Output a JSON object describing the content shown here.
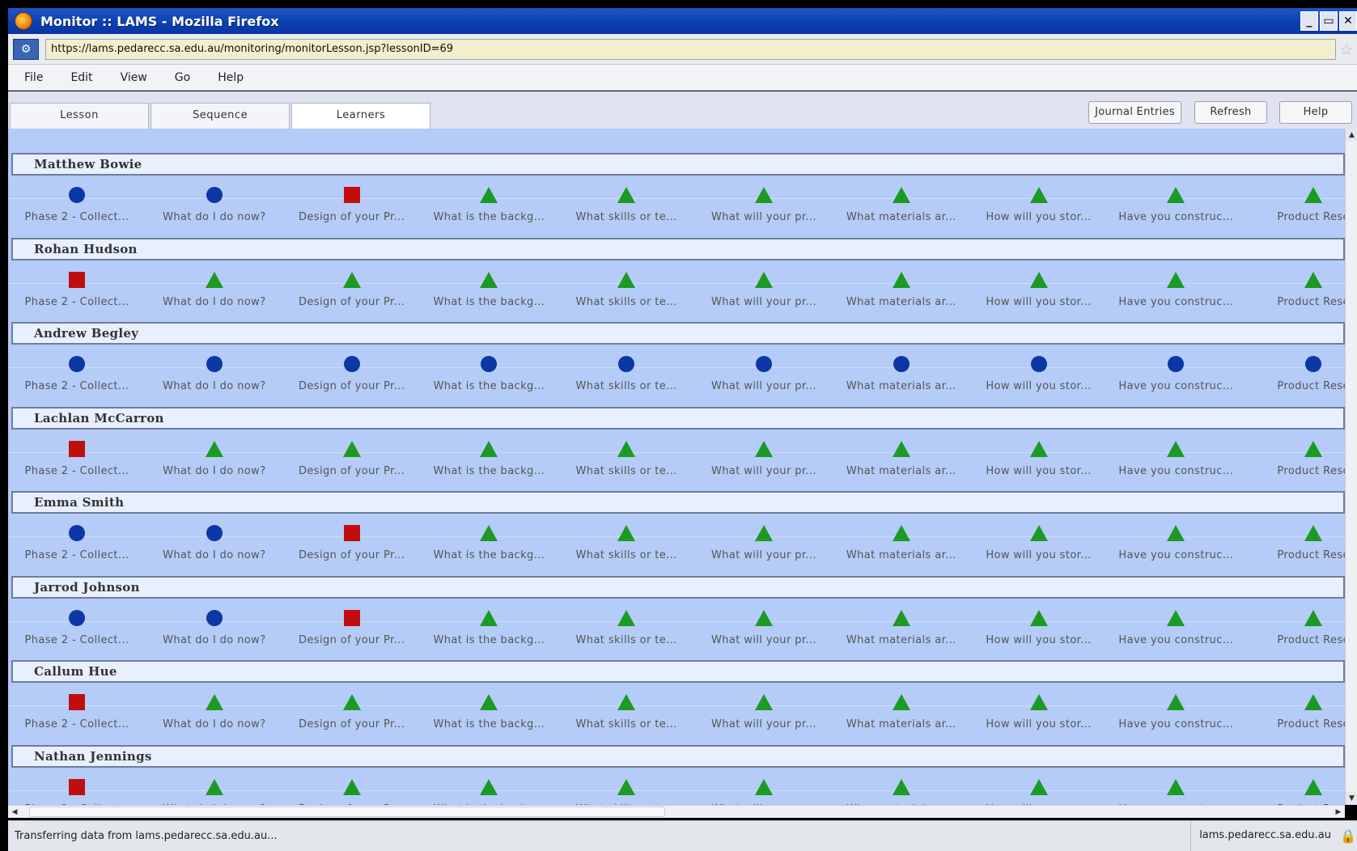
{
  "window": {
    "title": "Monitor :: LAMS - Mozilla Firefox",
    "buttons": [
      "_",
      "▭",
      "✕"
    ]
  },
  "address": {
    "url": "https://lams.pedarecc.sa.edu.au/monitoring/monitorLesson.jsp?lessonID=69"
  },
  "menu": [
    "File",
    "Edit",
    "View",
    "Go",
    "Help"
  ],
  "tabs": [
    {
      "label": "Lesson",
      "active": false
    },
    {
      "label": "Sequence",
      "active": false
    },
    {
      "label": "Learners",
      "active": true
    }
  ],
  "toolbar_buttons": [
    "Journal Entries",
    "Refresh",
    "Help"
  ],
  "activities": [
    "Phase 2 - Collect...",
    "What do I do now?",
    "Design of your Pr...",
    "What is the backg...",
    "What skills or te...",
    "What will your pr...",
    "What materials ar...",
    "How will you stor...",
    "Have you construc...",
    "Product Rese"
  ],
  "legend_colors": {
    "completed": "#0c37a5",
    "current": "#c00e0e",
    "not_started": "#1c9a23"
  },
  "learners": [
    {
      "name": "Matthew Bowie",
      "states": [
        "circle",
        "circle",
        "square",
        "triangle",
        "triangle",
        "triangle",
        "triangle",
        "triangle",
        "triangle",
        "triangle"
      ]
    },
    {
      "name": "Rohan Hudson",
      "states": [
        "square",
        "triangle",
        "triangle",
        "triangle",
        "triangle",
        "triangle",
        "triangle",
        "triangle",
        "triangle",
        "triangle"
      ]
    },
    {
      "name": "Andrew Begley",
      "states": [
        "circle",
        "circle",
        "circle",
        "circle",
        "circle",
        "circle",
        "circle",
        "circle",
        "circle",
        "circle"
      ]
    },
    {
      "name": "Lachlan McCarron",
      "states": [
        "square",
        "triangle",
        "triangle",
        "triangle",
        "triangle",
        "triangle",
        "triangle",
        "triangle",
        "triangle",
        "triangle"
      ]
    },
    {
      "name": "Emma Smith",
      "states": [
        "circle",
        "circle",
        "square",
        "triangle",
        "triangle",
        "triangle",
        "triangle",
        "triangle",
        "triangle",
        "triangle"
      ]
    },
    {
      "name": "Jarrod Johnson",
      "states": [
        "circle",
        "circle",
        "square",
        "triangle",
        "triangle",
        "triangle",
        "triangle",
        "triangle",
        "triangle",
        "triangle"
      ]
    },
    {
      "name": "Callum Hue",
      "states": [
        "square",
        "triangle",
        "triangle",
        "triangle",
        "triangle",
        "triangle",
        "triangle",
        "triangle",
        "triangle",
        "triangle"
      ]
    },
    {
      "name": "Nathan Jennings",
      "states": [
        "square",
        "triangle",
        "triangle",
        "triangle",
        "triangle",
        "triangle",
        "triangle",
        "triangle",
        "triangle",
        "triangle"
      ]
    }
  ],
  "status": {
    "text": "Transferring data from lams.pedarecc.sa.edu.au...",
    "host": "lams.pedarecc.sa.edu.au"
  }
}
